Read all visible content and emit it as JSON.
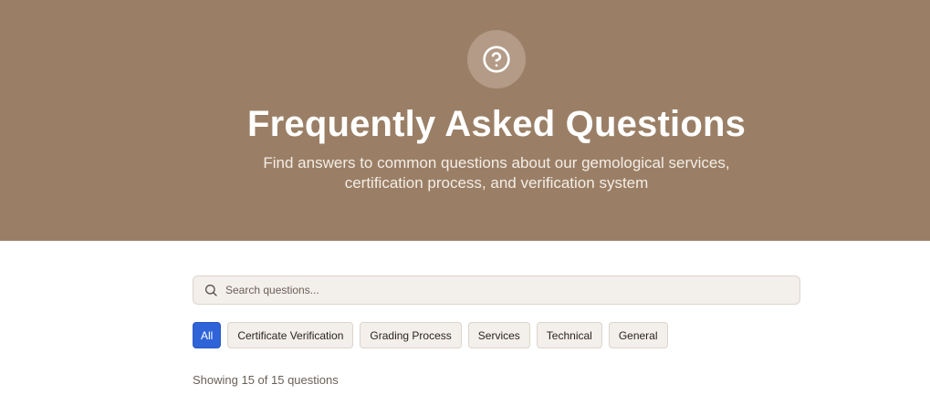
{
  "hero": {
    "icon": "question-circle-icon",
    "title": "Frequently Asked Questions",
    "subtitle": "Find answers to common questions about our gemological services, certification process, and verification system",
    "background_color": "#9a7f66"
  },
  "search": {
    "icon": "search-icon",
    "placeholder": "Search questions...",
    "value": ""
  },
  "filters": {
    "active": "All",
    "active_color": "#2f64d8",
    "items": [
      {
        "label": "All"
      },
      {
        "label": "Certificate Verification"
      },
      {
        "label": "Grading Process"
      },
      {
        "label": "Services"
      },
      {
        "label": "Technical"
      },
      {
        "label": "General"
      }
    ]
  },
  "results": {
    "count_text": "Showing 15 of 15 questions"
  }
}
